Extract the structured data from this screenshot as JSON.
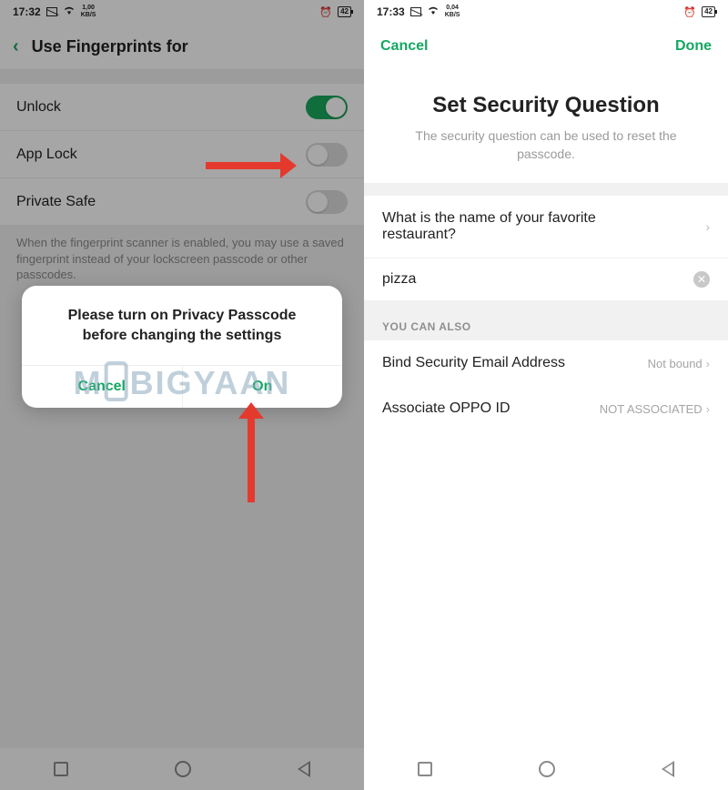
{
  "left": {
    "statusbar": {
      "time": "17:32",
      "kbs_top": "1,00",
      "kbs_bot": "KB/S",
      "battery": "42"
    },
    "header": {
      "title": "Use Fingerprints for"
    },
    "rows": {
      "unlock": "Unlock",
      "applock": "App Lock",
      "privatesafe": "Private Safe"
    },
    "help": "When the fingerprint scanner is enabled, you may use a saved fingerprint instead of your lockscreen passcode or other passcodes.",
    "dialog": {
      "message": "Please turn on Privacy Passcode before changing the settings",
      "cancel": "Cancel",
      "on": "On"
    },
    "watermark_left": "M",
    "watermark_right": "BIGYAAN"
  },
  "right": {
    "statusbar": {
      "time": "17:33",
      "kbs_top": "0,04",
      "kbs_bot": "KB/S",
      "battery": "42"
    },
    "header": {
      "cancel": "Cancel",
      "done": "Done"
    },
    "title": "Set Security Question",
    "subtitle": "The security question can be used to reset the passcode.",
    "question": "What is the name of your favorite restaurant?",
    "answer": "pizza",
    "section": "YOU CAN ALSO",
    "bind_email": {
      "label": "Bind Security Email Address",
      "status": "Not bound"
    },
    "oppo": {
      "label": "Associate OPPO ID",
      "status": "NOT ASSOCIATED"
    }
  }
}
